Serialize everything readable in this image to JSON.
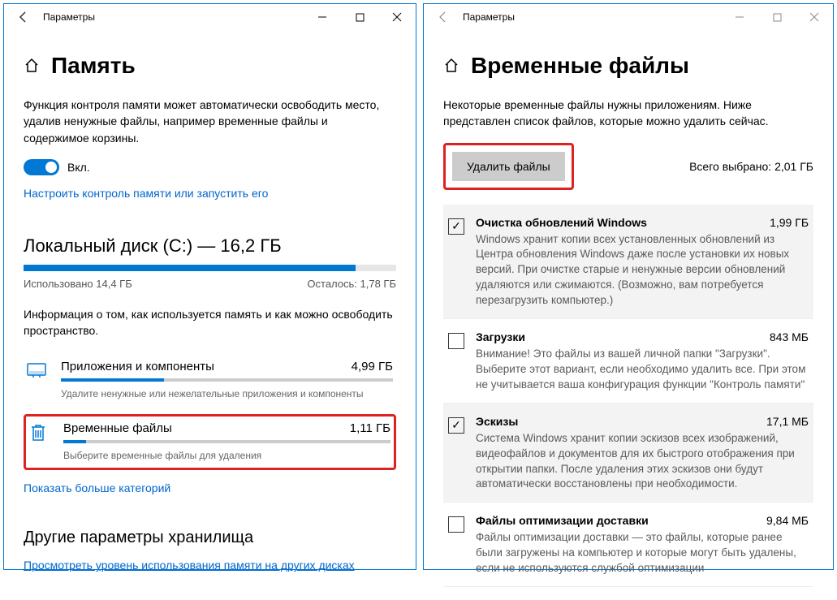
{
  "left": {
    "titlebar": "Параметры",
    "heading": "Память",
    "intro": "Функция контроля памяти может автоматически освободить место, удалив ненужные файлы, например временные файлы и содержимое корзины.",
    "toggle_label": "Вкл.",
    "configure_link": "Настроить контроль памяти или запустить его",
    "disk_heading": "Локальный диск (C:) — 16,2 ГБ",
    "used_label": "Использовано 14,4 ГБ",
    "remain_label": "Осталось: 1,78 ГБ",
    "info": "Информация о том, как используется память и как можно освободить пространство.",
    "categories": [
      {
        "label": "Приложения и компоненты",
        "size": "4,99 ГБ",
        "sub": "Удалите ненужные или нежелательные приложения и компоненты",
        "fill": 31
      },
      {
        "label": "Временные файлы",
        "size": "1,11 ГБ",
        "sub": "Выберите временные файлы для удаления",
        "fill": 7
      }
    ],
    "show_more": "Показать больше категорий",
    "other_heading": "Другие параметры хранилища",
    "other_link": "Просмотреть уровень использования памяти на других дисках"
  },
  "right": {
    "titlebar": "Параметры",
    "heading": "Временные файлы",
    "intro": "Некоторые временные файлы нужны приложениям. Ниже представлен список файлов, которые можно удалить сейчас.",
    "delete_btn": "Удалить файлы",
    "total_selected": "Всего выбрано: 2,01 ГБ",
    "items": [
      {
        "name": "Очистка обновлений Windows",
        "size": "1,99 ГБ",
        "checked": true,
        "alt": true,
        "desc": "Windows хранит копии всех установленных обновлений из Центра обновления Windows даже после установки их новых версий. При очистке старые и ненужные версии обновлений удаляются или сжимаются. (Возможно, вам потребуется перезагрузить компьютер.)"
      },
      {
        "name": "Загрузки",
        "size": "843 МБ",
        "checked": false,
        "alt": false,
        "desc": "Внимание! Это файлы из вашей личной папки \"Загрузки\". Выберите этот вариант, если необходимо удалить все. При этом не учитывается ваша конфигурация функции \"Контроль памяти\""
      },
      {
        "name": "Эскизы",
        "size": "17,1 МБ",
        "checked": true,
        "alt": true,
        "desc": "Система Windows хранит копии эскизов всех изображений, видеофайлов и документов для их быстрого отображения при открытии папки. После удаления этих эскизов они будут автоматически восстановлены при необходимости."
      },
      {
        "name": "Файлы оптимизации доставки",
        "size": "9,84 МБ",
        "checked": false,
        "alt": false,
        "desc": "Файлы оптимизации доставки — это файлы, которые ранее были загружены на компьютер и которые могут быть удалены, если не используются службой оптимизации"
      }
    ]
  }
}
